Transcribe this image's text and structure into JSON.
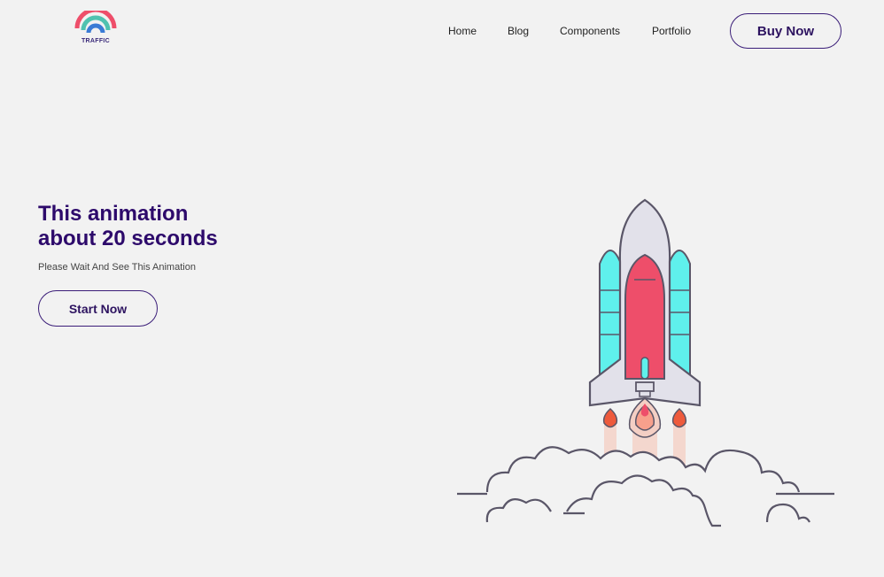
{
  "brand": {
    "logo_text": "TRAFFIC",
    "logo_icon": "wifi-arc-icon"
  },
  "nav": {
    "links": [
      {
        "label": "Home"
      },
      {
        "label": "Blog"
      },
      {
        "label": "Components"
      },
      {
        "label": "Portfolio"
      }
    ],
    "cta_label": "Buy Now"
  },
  "hero": {
    "title_line1": "This animation",
    "title_line2": "about 20 seconds",
    "subtitle": "Please Wait And See This Animation",
    "button_label": "Start Now"
  },
  "illustration": {
    "icon": "rocket-launch-icon"
  },
  "colors": {
    "background": "#f2f2f2",
    "primary": "#2d0a6b",
    "rocket_red": "#ee4e6a",
    "rocket_cyan": "#5ff0ec",
    "outline": "#5a5668"
  }
}
